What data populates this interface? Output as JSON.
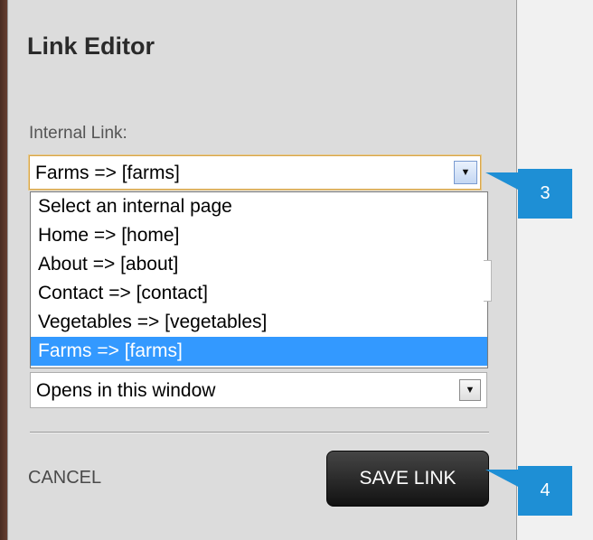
{
  "dialog": {
    "title": "Link Editor",
    "internal_link_label": "Internal Link:",
    "internal_link_selected": "Farms => [farms]",
    "dropdown_options": [
      "Select an internal page",
      "Home => [home]",
      "About => [about]",
      "Contact => [contact]",
      "Vegetables => [vegetables]",
      "Farms => [farms]"
    ],
    "selected_option_index": 5,
    "target_selected": "Opens in this window",
    "cancel_label": "CANCEL",
    "save_label": "SAVE LINK"
  },
  "callouts": {
    "step_a": "3",
    "step_b": "4"
  },
  "icons": {
    "dropdown_arrow": "chevron-down-icon"
  },
  "colors": {
    "highlight": "#3399ff",
    "callout": "#1e8fd5",
    "save_button": "#2a2a2a"
  }
}
